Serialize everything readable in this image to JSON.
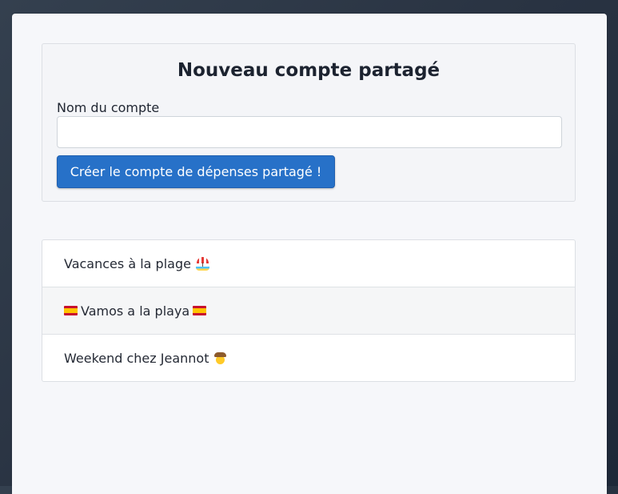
{
  "form": {
    "title": "Nouveau compte partagé",
    "name_label": "Nom du compte",
    "name_value": "",
    "name_placeholder": "",
    "submit_label": "Créer le compte de dépenses partagé !"
  },
  "accounts": [
    {
      "label": "Vacances à la plage",
      "icon": "beach-umbrella-icon"
    },
    {
      "label": "Vamos a la playa",
      "icon": "spain-flag-icon"
    },
    {
      "label": "Weekend chez Jeannot",
      "icon": "cowboy-face-icon"
    }
  ],
  "colors": {
    "accent": "#2771c8",
    "background": "#2a3443",
    "panel": "#f6f7fa"
  }
}
